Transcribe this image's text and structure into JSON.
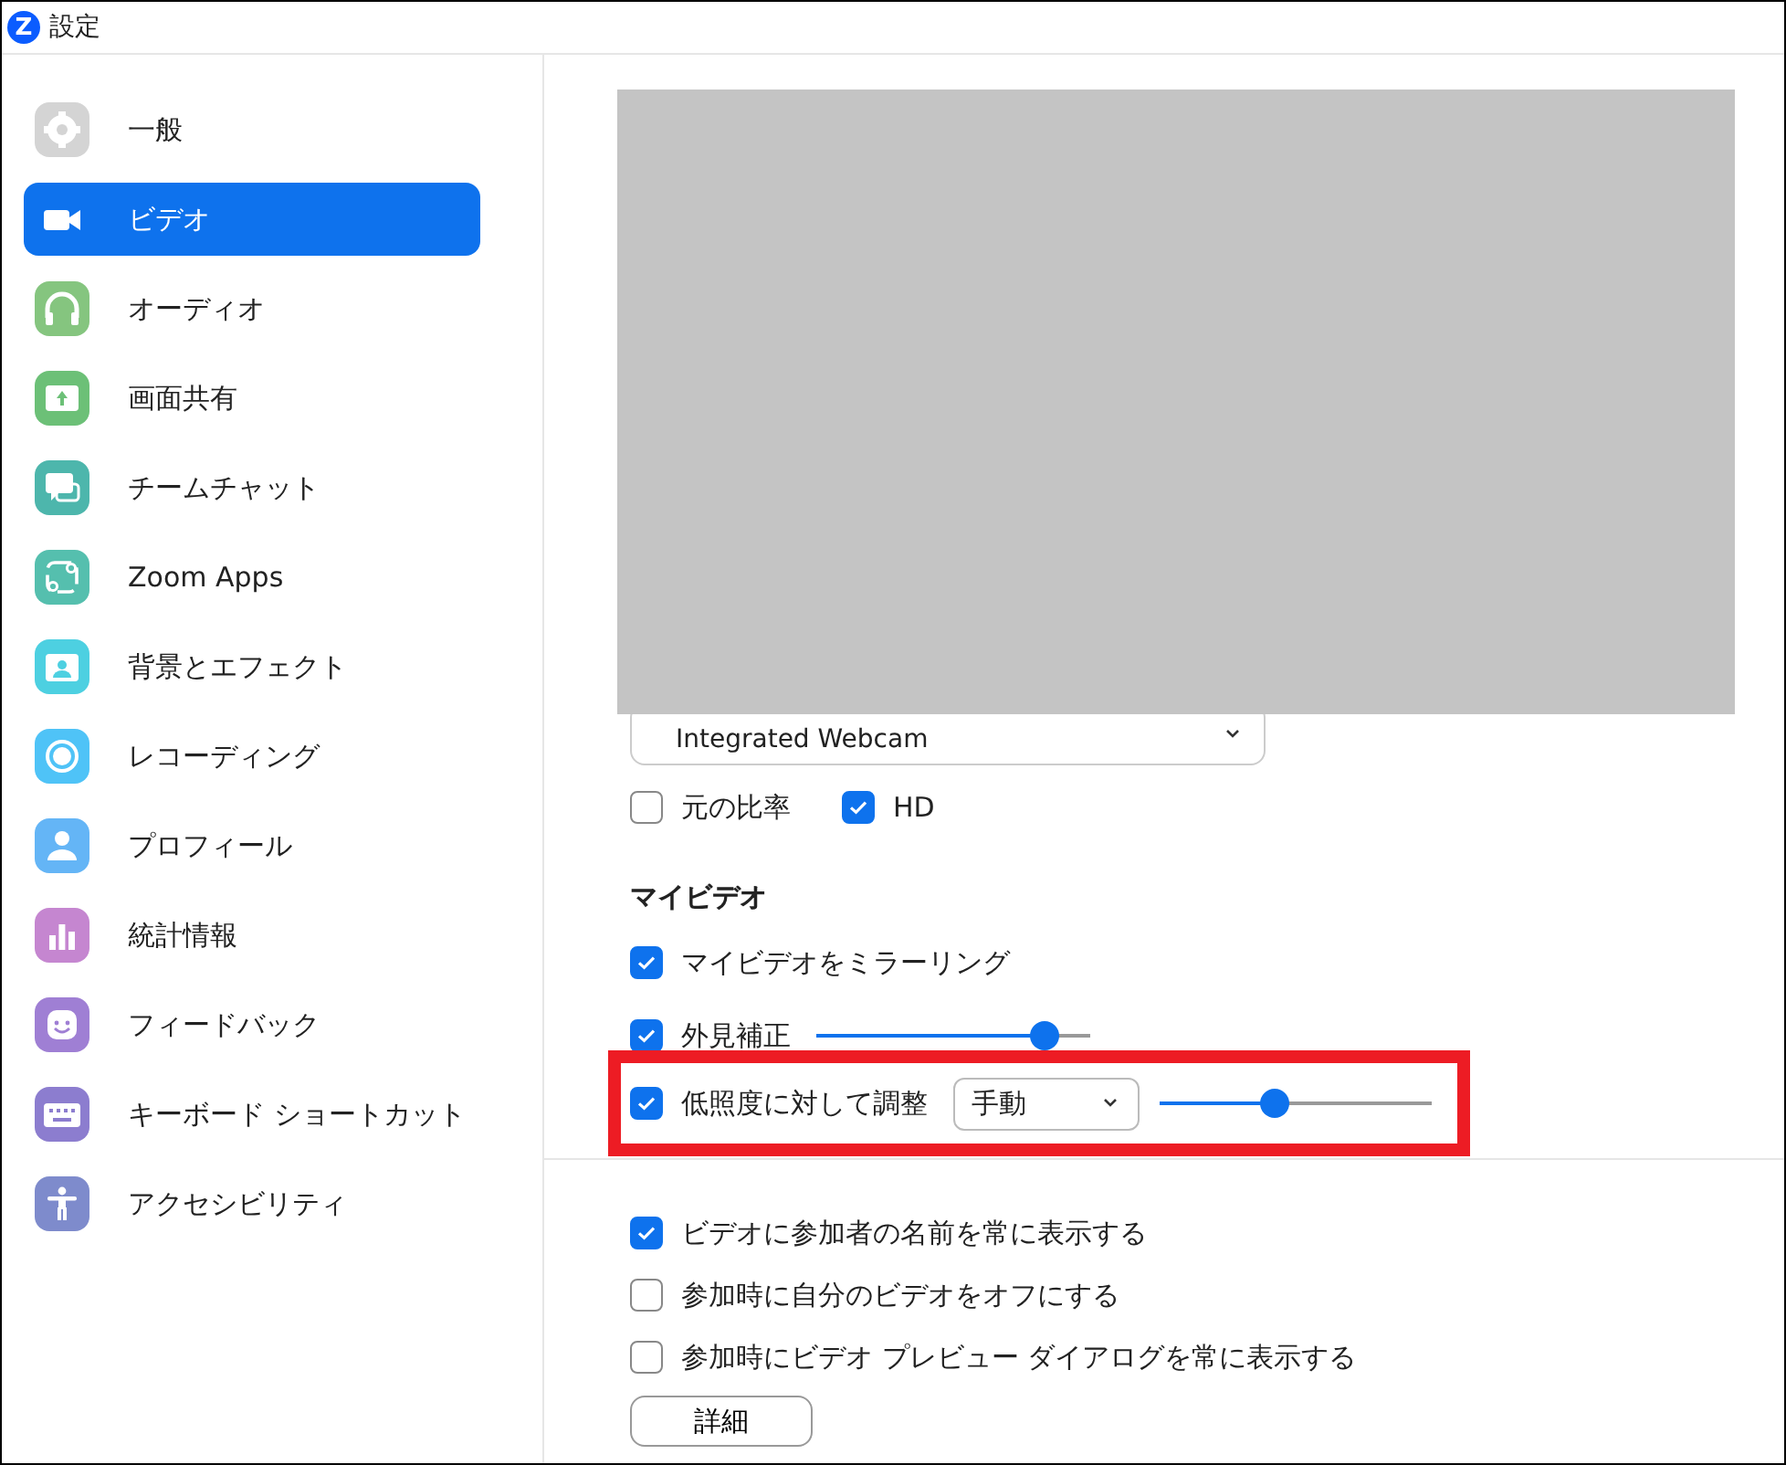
{
  "window": {
    "logo": "Z",
    "title": "設定"
  },
  "sidebar": {
    "items": [
      {
        "label": "一般",
        "kind": "gear",
        "color": "#d4d4d4",
        "selected": false
      },
      {
        "label": "ビデオ",
        "kind": "camera",
        "color": "#0e72ed",
        "selected": true
      },
      {
        "label": "オーディオ",
        "kind": "headphones",
        "color": "#85c57f",
        "selected": false
      },
      {
        "label": "画面共有",
        "kind": "share",
        "color": "#6cc077",
        "selected": false
      },
      {
        "label": "チームチャット",
        "kind": "chat",
        "color": "#4db6ac",
        "selected": false
      },
      {
        "label": "Zoom Apps",
        "kind": "apps",
        "color": "#55bfae",
        "selected": false
      },
      {
        "label": "背景とエフェクト",
        "kind": "background",
        "color": "#4dd0e1",
        "selected": false
      },
      {
        "label": "レコーディング",
        "kind": "record",
        "color": "#4fc3f7",
        "selected": false
      },
      {
        "label": "プロフィール",
        "kind": "profile",
        "color": "#64b5f6",
        "selected": false
      },
      {
        "label": "統計情報",
        "kind": "stats",
        "color": "#c586d0",
        "selected": false
      },
      {
        "label": "フィードバック",
        "kind": "feedback",
        "color": "#9f7fd4",
        "selected": false
      },
      {
        "label": "キーボード ショートカット",
        "kind": "keyboard",
        "color": "#8c7dcf",
        "selected": false
      },
      {
        "label": "アクセシビリティ",
        "kind": "accessibility",
        "color": "#7e8bcc",
        "selected": false
      }
    ]
  },
  "camera": {
    "value": "Integrated Webcam"
  },
  "format_options": [
    {
      "label": "元の比率",
      "checked": false
    },
    {
      "label": "HD",
      "checked": true
    }
  ],
  "my_video": {
    "heading": "マイビデオ",
    "options": [
      {
        "kind": "checkbox",
        "label": "マイビデオをミラーリング",
        "checked": true,
        "highlighted": false
      },
      {
        "kind": "slider",
        "label": "外見補正",
        "checked": true,
        "level": 0.83,
        "highlighted": false
      },
      {
        "kind": "select_slider",
        "label": "低照度に対して調整",
        "checked": true,
        "select": "手動",
        "level": 0.42,
        "highlighted": true
      }
    ]
  },
  "general_options": [
    {
      "label": "ビデオに参加者の名前を常に表示する",
      "checked": true
    },
    {
      "label": "参加時に自分のビデオをオフにする",
      "checked": false
    },
    {
      "label": "参加時にビデオ プレビュー ダイアログを常に表示する",
      "checked": false
    }
  ],
  "advanced_button": "詳細"
}
